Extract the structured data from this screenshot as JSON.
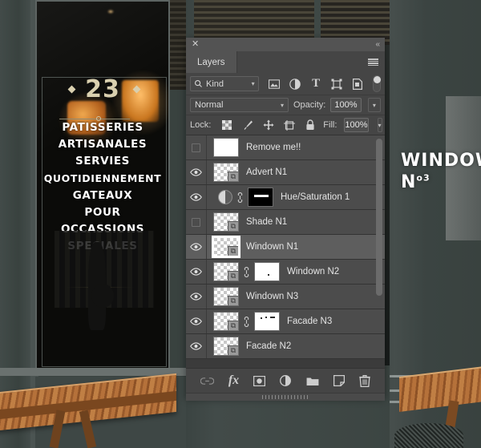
{
  "photo": {
    "shop_number": "23",
    "sign_lines_top": [
      "PATISSERIES",
      "ARTISANALES",
      "SERVIES",
      "QUOTIDIENNEMENT"
    ],
    "sign_lines_bottom": [
      "GATEAUX",
      "POUR",
      "OCCASSIONS",
      "SPECIALES"
    ],
    "right_sign_word": "WINDOW",
    "right_sign_no": "N",
    "right_sign_sup": "3",
    "right_sign_degree": "o"
  },
  "panel": {
    "close_label": "✕",
    "collapse_label": "«",
    "tab_label": "Layers",
    "menu_name": "panel-menu"
  },
  "filter": {
    "kind_label": "Kind",
    "icons": [
      {
        "name": "pixel-layer-filter-icon"
      },
      {
        "name": "adjustment-layer-filter-icon"
      },
      {
        "name": "type-layer-filter-icon",
        "glyph": "T"
      },
      {
        "name": "shape-layer-filter-icon"
      },
      {
        "name": "smart-object-filter-icon"
      }
    ],
    "toggle_name": "filter-enable-toggle"
  },
  "blend": {
    "mode": "Normal",
    "opacity_label": "Opacity:",
    "opacity_value": "100%"
  },
  "lock": {
    "label": "Lock:",
    "fill_label": "Fill:",
    "fill_value": "100%",
    "icons": [
      {
        "name": "lock-transparent-pixels-icon"
      },
      {
        "name": "lock-image-pixels-icon"
      },
      {
        "name": "lock-position-icon"
      },
      {
        "name": "lock-artboard-nesting-icon"
      },
      {
        "name": "lock-all-icon"
      }
    ]
  },
  "layers": [
    {
      "name": "Remove me!!",
      "visible": false,
      "selected": false,
      "thumb": "white",
      "mask": null,
      "adjustment": false,
      "linked": false
    },
    {
      "name": "Advert N1",
      "visible": true,
      "selected": false,
      "thumb": "transparent",
      "mask": null,
      "adjustment": false,
      "linked": false
    },
    {
      "name": "Hue/Saturation 1",
      "visible": true,
      "selected": false,
      "thumb": null,
      "mask": "black-stroke",
      "adjustment": true,
      "linked": true
    },
    {
      "name": "Shade N1",
      "visible": false,
      "selected": false,
      "thumb": "transparent",
      "mask": null,
      "adjustment": false,
      "linked": false
    },
    {
      "name": "Windown N1",
      "visible": true,
      "selected": true,
      "thumb": "transparent",
      "mask": null,
      "adjustment": false,
      "linked": false
    },
    {
      "name": "Windown N2",
      "visible": true,
      "selected": false,
      "thumb": "transparent",
      "mask": "white-dot",
      "adjustment": false,
      "linked": true
    },
    {
      "name": "Windown N3",
      "visible": true,
      "selected": false,
      "thumb": "transparent",
      "mask": null,
      "adjustment": false,
      "linked": false
    },
    {
      "name": "Facade N3",
      "visible": true,
      "selected": false,
      "thumb": "transparent",
      "mask": "white-marks",
      "adjustment": false,
      "linked": true
    },
    {
      "name": "Facade N2",
      "visible": true,
      "selected": false,
      "thumb": "transparent",
      "mask": null,
      "adjustment": false,
      "linked": false
    }
  ],
  "bottom_toolbar": [
    {
      "name": "link-layers-button",
      "label": "Link layers"
    },
    {
      "name": "layer-style-fx-button",
      "label": "fx"
    },
    {
      "name": "add-layer-mask-button",
      "label": "Add layer mask"
    },
    {
      "name": "new-adjustment-layer-button",
      "label": "New adjustment layer"
    },
    {
      "name": "new-group-button",
      "label": "New group"
    },
    {
      "name": "new-layer-button",
      "label": "New layer"
    },
    {
      "name": "delete-layer-button",
      "label": "Delete layer"
    }
  ],
  "colors": {
    "panel_bg": "#393939",
    "row_bg": "#4c4c4c",
    "row_selected_bg": "#5e5e5e",
    "header_bg": "#454545",
    "text": "#e4e4e4"
  }
}
